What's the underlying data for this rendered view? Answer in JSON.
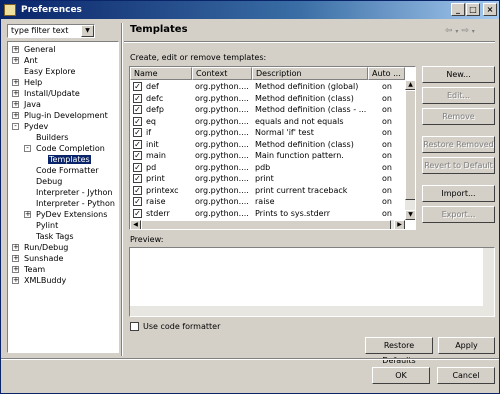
{
  "window": {
    "title": "Preferences"
  },
  "filter": {
    "value": "type filter text"
  },
  "tree": [
    {
      "label": "General",
      "expander": "+"
    },
    {
      "label": "Ant",
      "expander": "+"
    },
    {
      "label": "Easy Explore",
      "expander": ""
    },
    {
      "label": "Help",
      "expander": "+"
    },
    {
      "label": "Install/Update",
      "expander": "+"
    },
    {
      "label": "Java",
      "expander": "+"
    },
    {
      "label": "Plug-in Development",
      "expander": "+"
    },
    {
      "label": "Pydev",
      "expander": "−"
    },
    {
      "label": "Builders",
      "expander": ""
    },
    {
      "label": "Code Completion",
      "expander": "−"
    },
    {
      "label": "Templates",
      "expander": ""
    },
    {
      "label": "Code Formatter",
      "expander": ""
    },
    {
      "label": "Debug",
      "expander": ""
    },
    {
      "label": "Interpreter - Jython",
      "expander": ""
    },
    {
      "label": "Interpreter - Python",
      "expander": ""
    },
    {
      "label": "PyDev Extensions",
      "expander": "+"
    },
    {
      "label": "Pylint",
      "expander": ""
    },
    {
      "label": "Task Tags",
      "expander": ""
    },
    {
      "label": "Run/Debug",
      "expander": "+"
    },
    {
      "label": "Sunshade",
      "expander": "+"
    },
    {
      "label": "Team",
      "expander": "+"
    },
    {
      "label": "XMLBuddy",
      "expander": "+"
    }
  ],
  "page": {
    "title": "Templates",
    "section_label": "Create, edit or remove templates:",
    "nav_icons": [
      "back-arrow",
      "forward-arrow",
      "menu-arrow"
    ]
  },
  "table": {
    "columns": [
      "Name",
      "Context",
      "Description",
      "Auto ..."
    ],
    "rows": [
      {
        "checked": true,
        "name": "def",
        "context": "org.python....",
        "description": "Method definition (global)",
        "auto": "on"
      },
      {
        "checked": true,
        "name": "defc",
        "context": "org.python....",
        "description": "Method definition (class)",
        "auto": "on"
      },
      {
        "checked": true,
        "name": "defp",
        "context": "org.python....",
        "description": "Method definition (class - ...",
        "auto": "on"
      },
      {
        "checked": true,
        "name": "eq",
        "context": "org.python....",
        "description": "equals and not equals",
        "auto": "on"
      },
      {
        "checked": true,
        "name": "if",
        "context": "org.python....",
        "description": "Normal 'if' test",
        "auto": "on"
      },
      {
        "checked": true,
        "name": "init",
        "context": "org.python....",
        "description": "Method definition (class)",
        "auto": "on"
      },
      {
        "checked": true,
        "name": "main",
        "context": "org.python....",
        "description": "Main function pattern.",
        "auto": "on"
      },
      {
        "checked": true,
        "name": "pd",
        "context": "org.python....",
        "description": "pdb",
        "auto": "on"
      },
      {
        "checked": true,
        "name": "print",
        "context": "org.python....",
        "description": "print",
        "auto": "on"
      },
      {
        "checked": true,
        "name": "printexc",
        "context": "org.python....",
        "description": "print current traceback",
        "auto": "on"
      },
      {
        "checked": true,
        "name": "raise",
        "context": "org.python....",
        "description": "raise",
        "auto": "on"
      },
      {
        "checked": true,
        "name": "stderr",
        "context": "org.python....",
        "description": "Prints to sys.stderr",
        "auto": "on"
      }
    ]
  },
  "buttons": {
    "new": "New...",
    "edit": "Edit...",
    "remove": "Remove",
    "restore_removed": "Restore Removed",
    "revert_default": "Revert to Default",
    "import": "Import...",
    "export": "Export...",
    "restore_defaults": "Restore Defaults",
    "apply": "Apply",
    "ok": "OK",
    "cancel": "Cancel"
  },
  "preview": {
    "label": "Preview:"
  },
  "formatter": {
    "label": "Use code formatter",
    "checked": false
  }
}
